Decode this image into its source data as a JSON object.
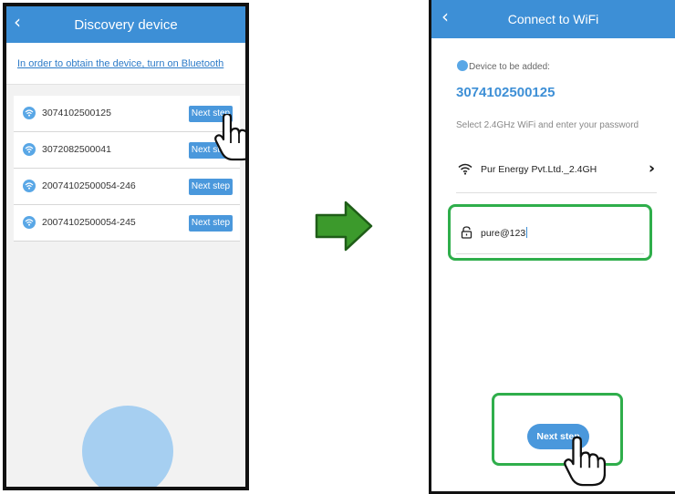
{
  "left_screen": {
    "back_icon": "chevron-left-icon",
    "title": "Discovery device",
    "bluetooth_notice": "In order to obtain the device, turn on Bluetooth",
    "devices": [
      {
        "id": "3074102500125",
        "button": "Next step"
      },
      {
        "id": "3072082500041",
        "button": "Next step"
      },
      {
        "id": "20074102500054-246",
        "button": "Next step"
      },
      {
        "id": "20074102500054-245",
        "button": "Next step"
      }
    ]
  },
  "right_screen": {
    "back_icon": "chevron-left-icon",
    "title": "Connect to WiFi",
    "device_label": "Device to be added:",
    "device_id": "3074102500125",
    "wifi_hint": "Select 2.4GHz WiFi and enter your password",
    "ssid": "Pur Energy Pvt.Ltd._2.4GH",
    "password": "pure@123",
    "next_button": "Next step"
  },
  "colors": {
    "header": "#3d8fd6",
    "button": "#4a98dc",
    "highlight": "#2fae4b",
    "arrow_fill": "#3c9a2c",
    "bluetooth_circle": "#a6cff1"
  }
}
